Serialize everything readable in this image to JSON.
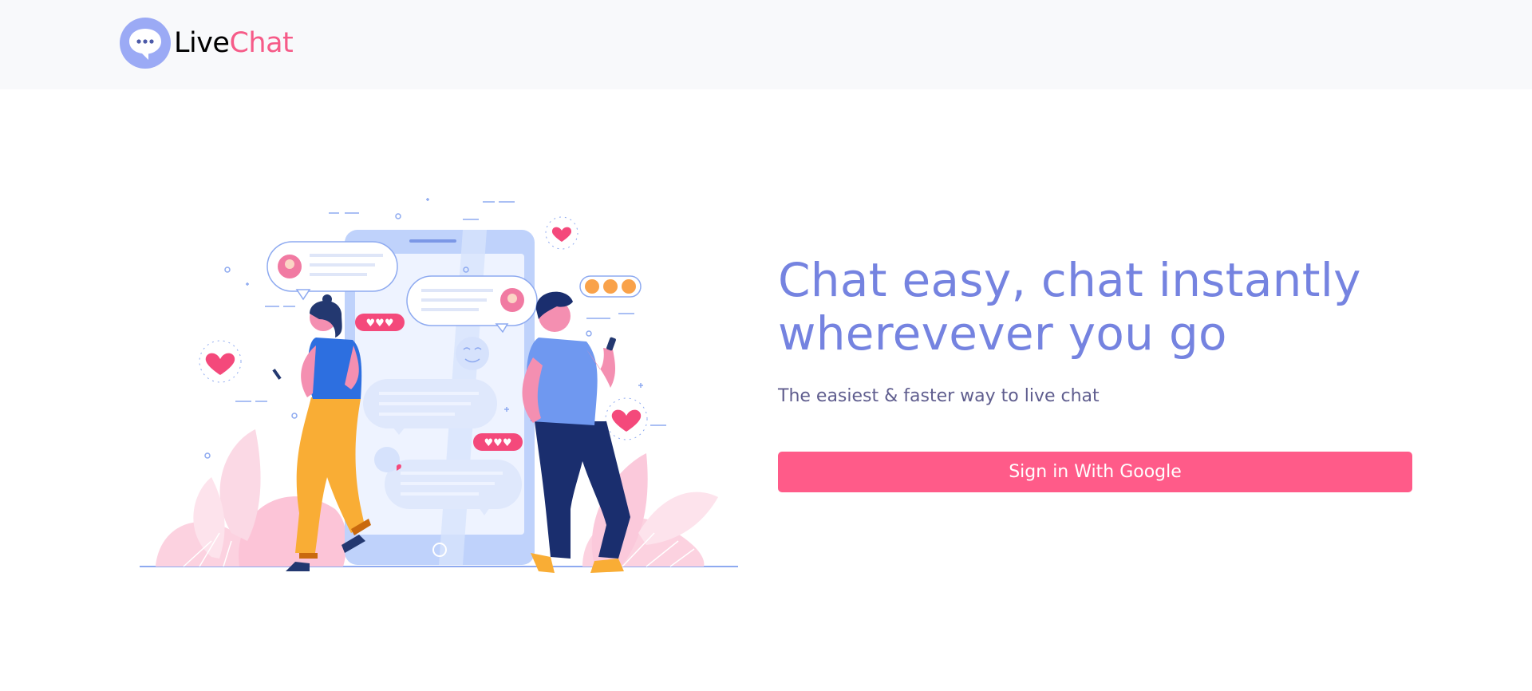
{
  "brand": {
    "name_part1": "Live",
    "name_part2": "Chat",
    "logo_icon": "chat-bubble-icon"
  },
  "hero": {
    "headline": "Chat easy, chat instantly wherevever you go",
    "subline": "The easiest & faster way to live chat",
    "cta_label": "Sign in With Google"
  },
  "colors": {
    "topbar_bg": "#f8f9fb",
    "headline": "#7583e0",
    "subline": "#5f5d8e",
    "brand_accent": "#f65b88",
    "cta_bg": "#ff5b89",
    "logo_circle": "#9baaf5"
  }
}
